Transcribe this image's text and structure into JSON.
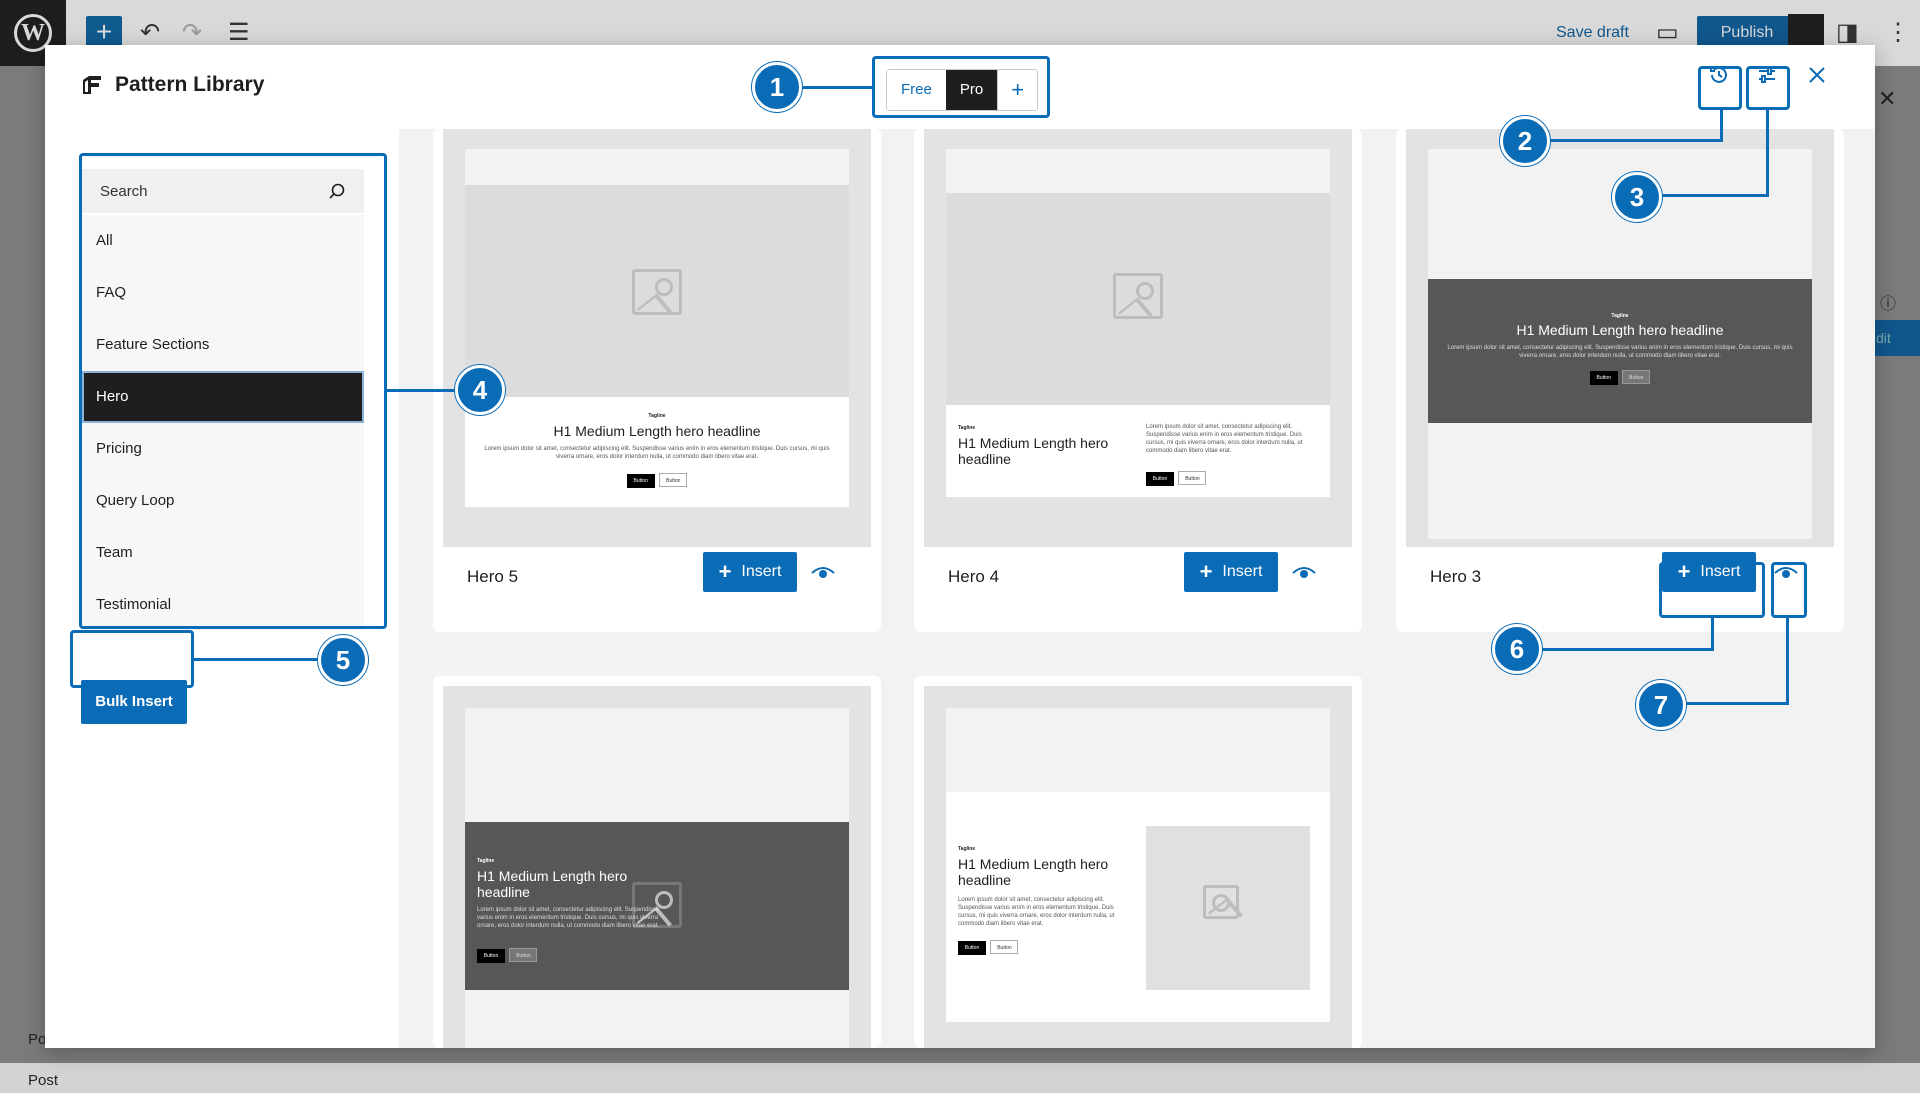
{
  "editor": {
    "save_draft": "Save draft",
    "publish": "Publish",
    "footer_tab": "Post",
    "footer_tab_partial": "Po",
    "sidebar_button_partial": "dit"
  },
  "modal": {
    "title": "Pattern Library",
    "library_tabs": [
      "Free",
      "Pro",
      "+"
    ],
    "active_tab": "Pro"
  },
  "sidebar": {
    "search_placeholder": "Search",
    "categories": [
      "All",
      "FAQ",
      "Feature Sections",
      "Hero",
      "Pricing",
      "Query Loop",
      "Team",
      "Testimonial"
    ],
    "active_category": "Hero",
    "bulk_insert": "Bulk Insert"
  },
  "patterns": [
    {
      "name": "Hero 5",
      "insert": "Insert"
    },
    {
      "name": "Hero 4",
      "insert": "Insert"
    },
    {
      "name": "Hero 3",
      "insert": "Insert"
    },
    {
      "name": "",
      "insert": ""
    },
    {
      "name": "",
      "insert": ""
    }
  ],
  "preview": {
    "tagline": "Tagline",
    "headline": "H1 Medium Length hero headline",
    "body": "Lorem ipsum dolor sit amet, consectetur adipiscing elit. Suspendisse varius enim in eros elementum tristique. Duis cursus, mi quis viverra ornare, eros dolor interdum nulla, ut commodo diam libero vitae erat.",
    "button_primary": "Button",
    "button_secondary": "Button"
  },
  "annotations": [
    "1",
    "2",
    "3",
    "4",
    "5",
    "6",
    "7"
  ],
  "colors": {
    "accent": "#0a6bb6",
    "dark": "#1e1e1e",
    "hero_dark_bg": "#575757"
  }
}
